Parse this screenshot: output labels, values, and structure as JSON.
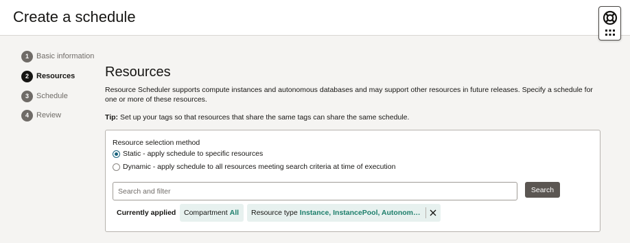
{
  "header": {
    "title": "Create a schedule"
  },
  "help": {
    "icon": "lifebuoy-icon",
    "menu_icon": "grid-dots-icon"
  },
  "steps": [
    {
      "num": "1",
      "label": "Basic information"
    },
    {
      "num": "2",
      "label": "Resources",
      "active": true
    },
    {
      "num": "3",
      "label": "Schedule"
    },
    {
      "num": "4",
      "label": "Review"
    }
  ],
  "main": {
    "heading": "Resources",
    "description": "Resource Scheduler supports compute instances and autonomous databases and may support other resources in future releases. Specify a schedule for one or more of these resources.",
    "tip_label": "Tip:",
    "tip_text": " Set up your tags so that resources that share the same tags can share the same schedule."
  },
  "selection": {
    "label": "Resource selection method",
    "options": [
      {
        "label": "Static - apply schedule to specific resources",
        "checked": true
      },
      {
        "label": "Dynamic - apply schedule to all resources meeting search criteria at time of execution",
        "checked": false
      }
    ]
  },
  "search": {
    "placeholder": "Search and filter",
    "value": "",
    "button_label": "Search"
  },
  "filters": {
    "label": "Currently applied",
    "chips": [
      {
        "key": "Compartment",
        "value": "All"
      },
      {
        "key": "Resource type",
        "value": "Instance, InstancePool, Autonomous Database",
        "close_icon": "close-icon"
      }
    ]
  },
  "colors": {
    "accent": "#15617c",
    "chip_bg": "#e7f1ef",
    "chip_value": "#1d7e6b",
    "button": "#5b5652"
  }
}
